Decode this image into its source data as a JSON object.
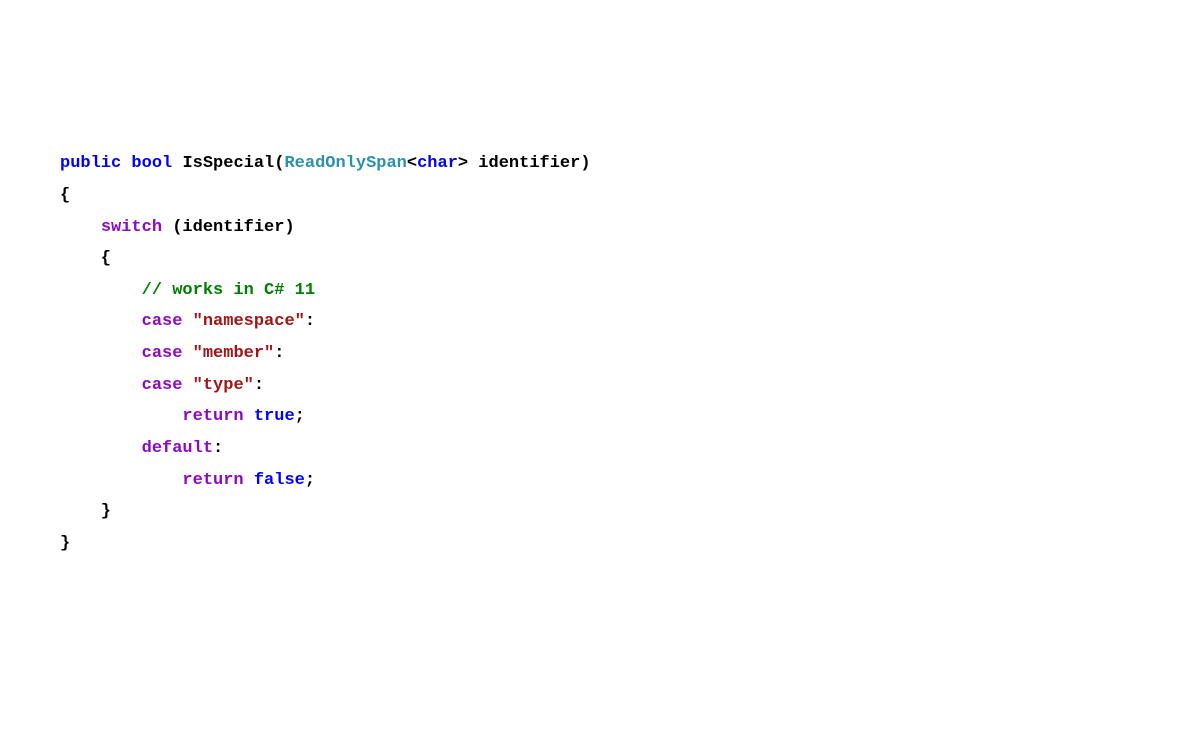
{
  "line1": {
    "public": "public",
    "bool": "bool",
    "method": "IsSpecial",
    "paren_open": "(",
    "readonlyspan": "ReadOnlySpan",
    "lt": "<",
    "char": "char",
    "gt": ">",
    "param": " identifier",
    "paren_close": ")"
  },
  "line2": {
    "brace": "{"
  },
  "line3": {
    "switch": "switch",
    "after": " (identifier)"
  },
  "line4": {
    "brace": "    {"
  },
  "line5": {
    "comment": "        // works in C# 11"
  },
  "line6": {
    "case": "case",
    "str": "\"namespace\"",
    "colon": ":"
  },
  "line7": {
    "case": "case",
    "str": "\"member\"",
    "colon": ":"
  },
  "line8": {
    "case": "case",
    "str": "\"type\"",
    "colon": ":"
  },
  "line9": {
    "return": "return",
    "true": "true",
    "semi": ";"
  },
  "line10": {
    "default": "default",
    "colon": ":"
  },
  "line11": {
    "return": "return",
    "false": "false",
    "semi": ";"
  },
  "line12": {
    "brace": "    }"
  },
  "line13": {
    "brace": "}"
  }
}
